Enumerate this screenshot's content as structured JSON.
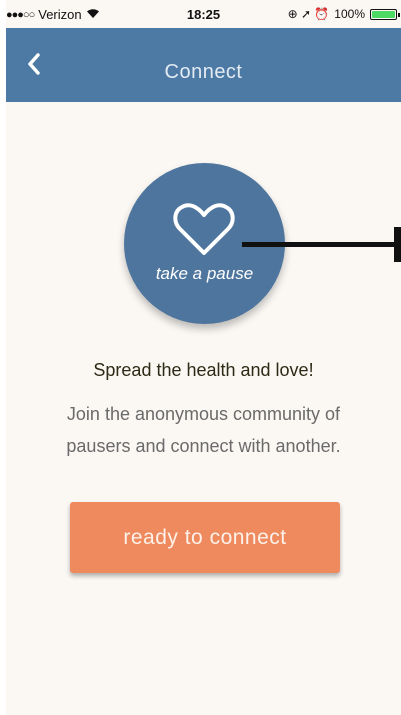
{
  "status_bar": {
    "signal": "●●●○○",
    "carrier": "Verizon",
    "wifi_icon": "wifi-icon",
    "time": "18:25",
    "right_icons": "⊕ ➚ ⏰",
    "battery_percent": "100%",
    "battery_level": 1.0,
    "battery_color": "#4cd964"
  },
  "nav": {
    "title": "Connect",
    "back_icon": "chevron-left-icon",
    "background": "#4d7aa4"
  },
  "main": {
    "circle_label": "take a pause",
    "circle_icon": "heart-icon",
    "circle_color": "#4e759d",
    "headline": "Spread the health and love!",
    "body": "Join the anonymous community of pausers and connect with another."
  },
  "connect_button": {
    "label": "ready to connect",
    "color": "#ef8a5e"
  }
}
